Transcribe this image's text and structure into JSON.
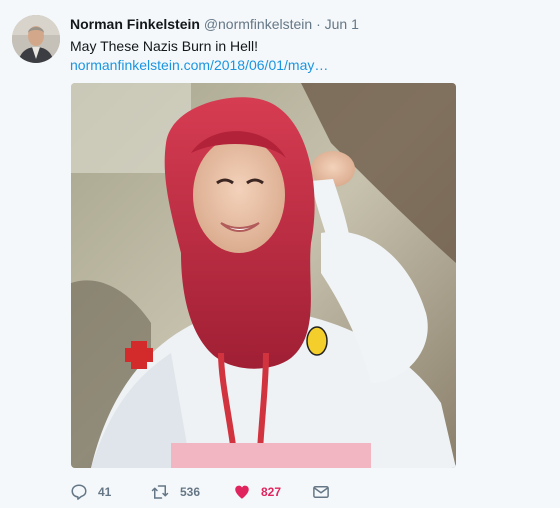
{
  "tweet": {
    "author_name": "Norman Finkelstein",
    "handle": "@normfinkelstein",
    "separator": "·",
    "date": "Jun 1",
    "text": "May These Nazis Burn in Hell!",
    "link_text": "normanfinkelstein.com/2018/06/01/may…"
  },
  "actions": {
    "reply": {
      "icon": "reply-icon",
      "count": "41"
    },
    "retweet": {
      "icon": "retweet-icon",
      "count": "536"
    },
    "like": {
      "icon": "heart-icon",
      "count": "827",
      "active": true
    },
    "message": {
      "icon": "envelope-icon"
    }
  },
  "colors": {
    "link": "#1b95e0",
    "like_active": "#e0245e",
    "muted": "#657786",
    "background": "#f5f8fa"
  }
}
